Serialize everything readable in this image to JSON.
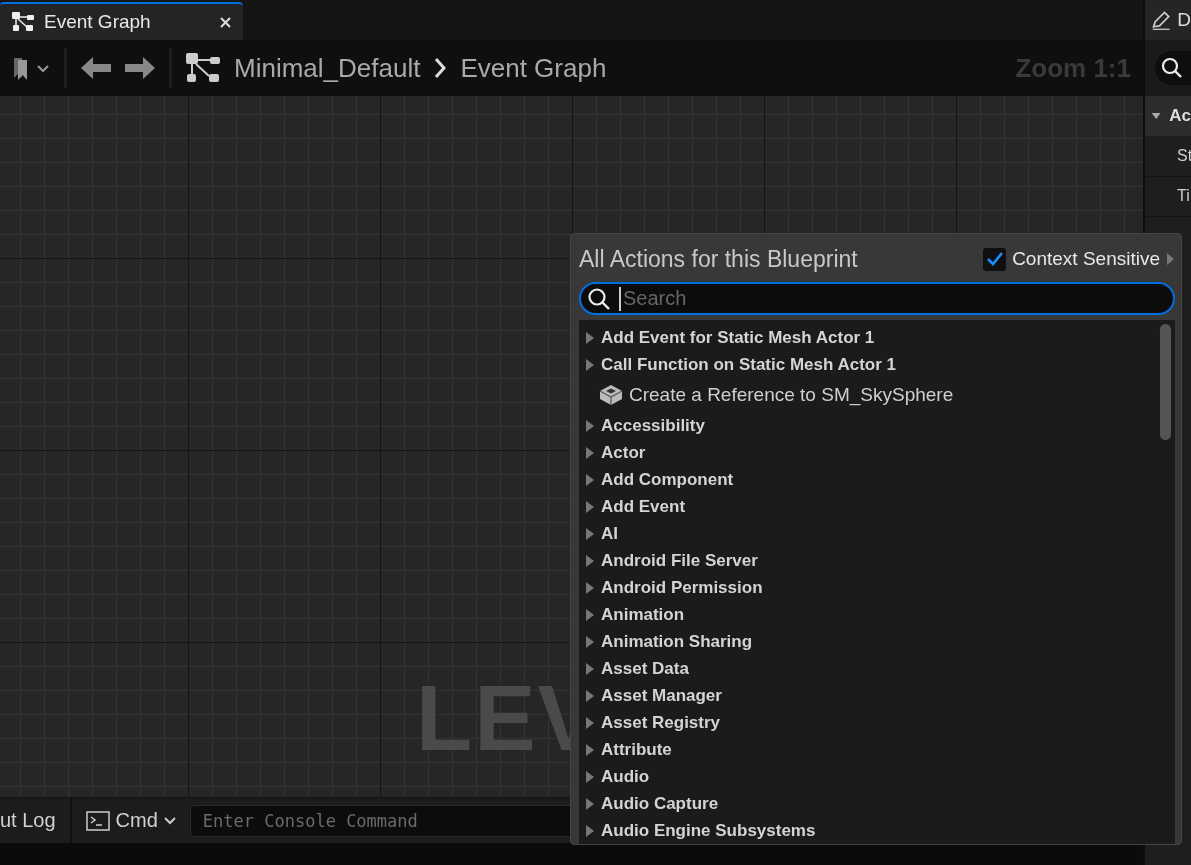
{
  "tab": {
    "title": "Event Graph",
    "selected": true
  },
  "toolbar": {
    "breadcrumb": [
      "Minimal_Default",
      "Event Graph"
    ],
    "zoom": "Zoom 1:1"
  },
  "canvas": {
    "watermark": "LEV"
  },
  "details_panel": {
    "title": "D",
    "section": "Ac",
    "rows": [
      "St",
      "Ti"
    ]
  },
  "console": {
    "log_tab": "ut Log",
    "cmd": "Cmd",
    "placeholder": "Enter Console Command"
  },
  "action_menu": {
    "title": "All Actions for this Blueprint",
    "context_sensitive": {
      "label": "Context Sensitive",
      "checked": true
    },
    "search": {
      "placeholder": "Search"
    },
    "items": [
      {
        "kind": "category",
        "label": "Add Event for Static Mesh Actor 1"
      },
      {
        "kind": "category",
        "label": "Call Function on Static Mesh Actor 1"
      },
      {
        "kind": "reference",
        "label": "Create a Reference to SM_SkySphere"
      },
      {
        "kind": "category",
        "label": "Accessibility"
      },
      {
        "kind": "category",
        "label": "Actor"
      },
      {
        "kind": "category",
        "label": "Add Component"
      },
      {
        "kind": "category",
        "label": "Add Event"
      },
      {
        "kind": "category",
        "label": "AI"
      },
      {
        "kind": "category",
        "label": "Android File Server"
      },
      {
        "kind": "category",
        "label": "Android Permission"
      },
      {
        "kind": "category",
        "label": "Animation"
      },
      {
        "kind": "category",
        "label": "Animation Sharing"
      },
      {
        "kind": "category",
        "label": "Asset Data"
      },
      {
        "kind": "category",
        "label": "Asset Manager"
      },
      {
        "kind": "category",
        "label": "Asset Registry"
      },
      {
        "kind": "category",
        "label": "Attribute"
      },
      {
        "kind": "category",
        "label": "Audio"
      },
      {
        "kind": "category",
        "label": "Audio Capture"
      },
      {
        "kind": "category",
        "label": "Audio Engine Subsystems"
      }
    ]
  }
}
